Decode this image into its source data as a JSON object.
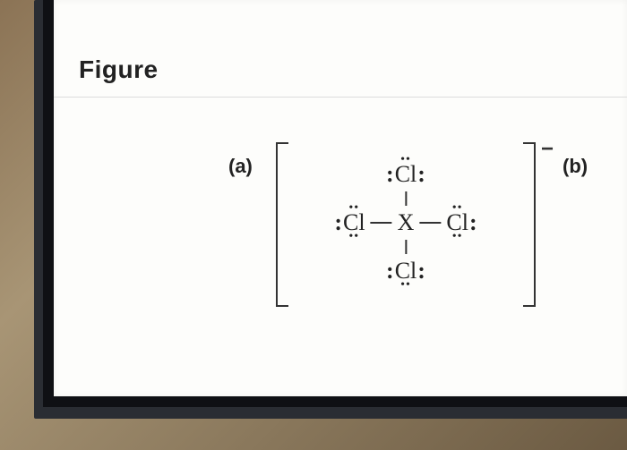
{
  "header": {
    "title": "Figure"
  },
  "labels": {
    "a": "(a)",
    "b": "(b)"
  },
  "structure": {
    "charge": "−",
    "top": {
      "left_lp": ":",
      "element": "Cl",
      "right_lp": ":",
      "top_lp": "••"
    },
    "left": {
      "left_lp": ":",
      "element": "Cl",
      "top_lp": "••",
      "bottom_lp": "••"
    },
    "center": {
      "element": "X"
    },
    "right": {
      "element": "Cl",
      "right_lp": ":",
      "top_lp": "••",
      "bottom_lp": "••"
    },
    "bottom": {
      "left_lp": ":",
      "element": "Cl",
      "right_lp": ":",
      "bottom_lp": "••"
    }
  }
}
